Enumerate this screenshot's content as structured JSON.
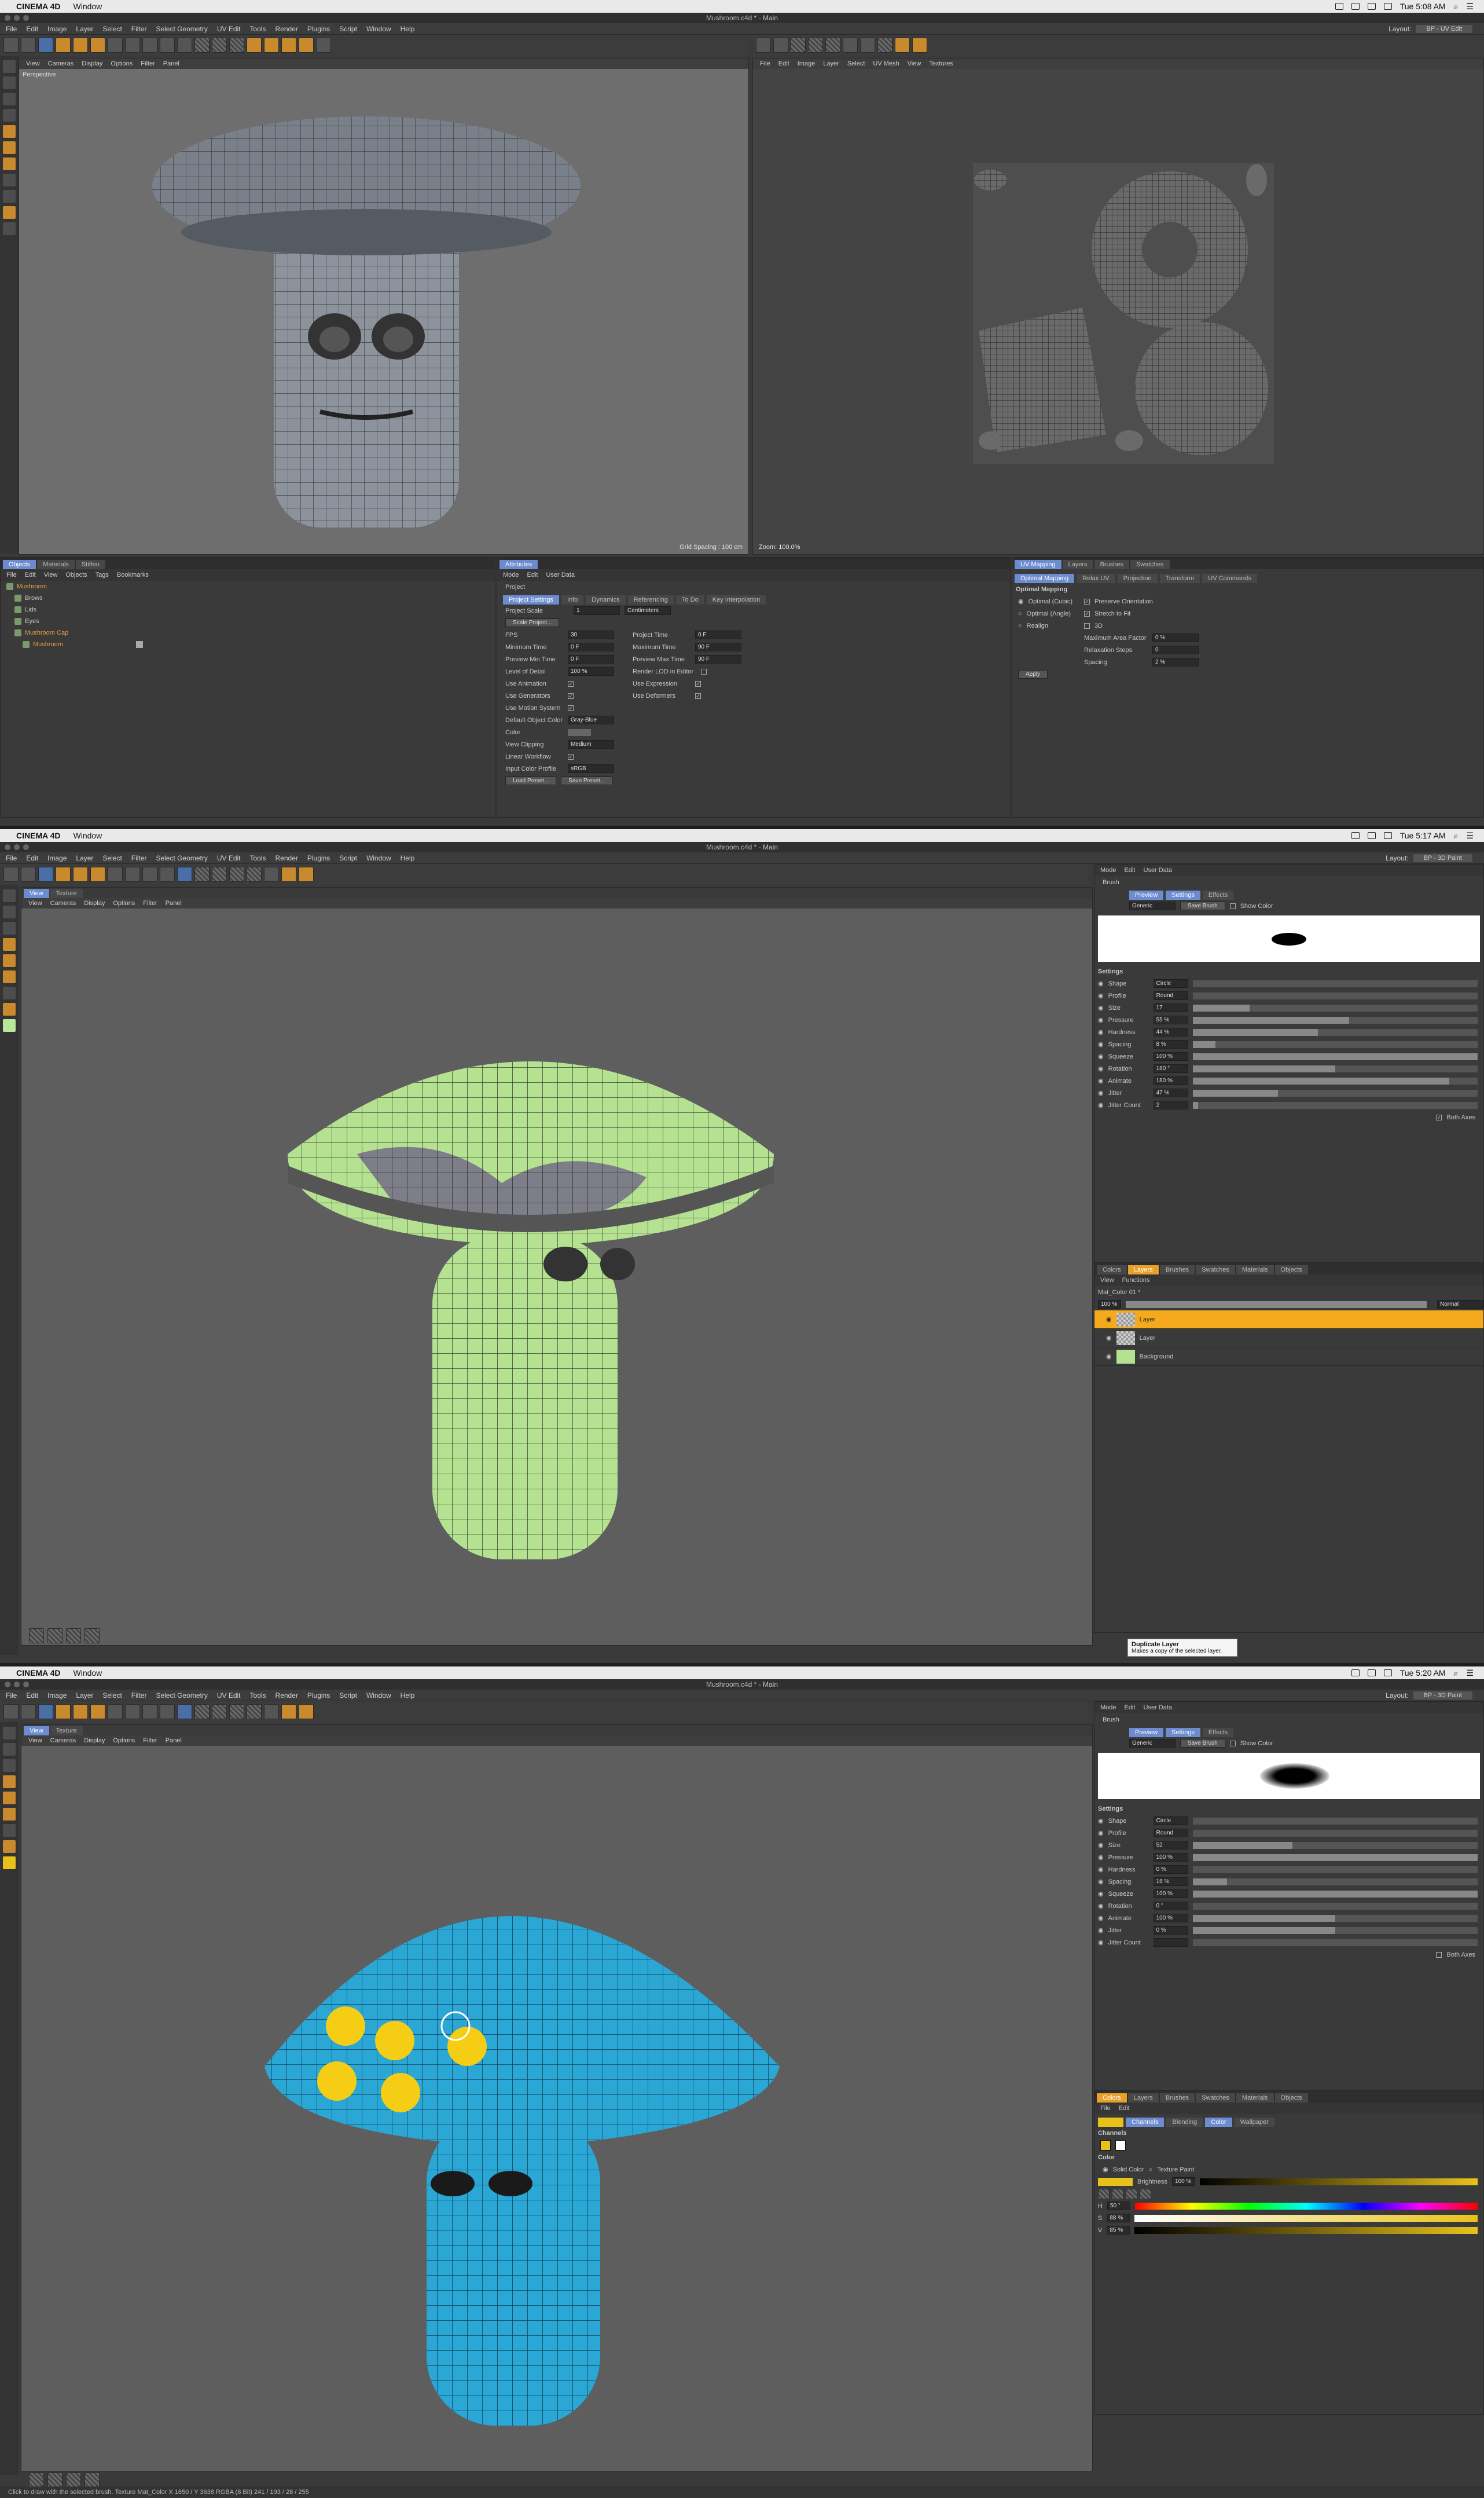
{
  "screens": [
    {
      "mac": {
        "app": "CINEMA 4D",
        "menu": [
          "Window"
        ],
        "time": "Tue 5:08 AM"
      },
      "title": "Mushroom.c4d * - Main",
      "menus": [
        "File",
        "Edit",
        "Image",
        "Layer",
        "Select",
        "Filter",
        "Select Geometry",
        "UV Edit",
        "Tools",
        "Render",
        "Plugins",
        "Script",
        "Window",
        "Help"
      ],
      "layout": {
        "label": "Layout:",
        "value": "BP - UV Edit"
      },
      "viewport": {
        "menu": [
          "View",
          "Cameras",
          "Display",
          "Options",
          "Filter",
          "Panel"
        ],
        "label": "Perspective",
        "footer": "Grid Spacing : 100 cm"
      },
      "uv_view": {
        "menu": [
          "File",
          "Edit",
          "Image",
          "Layer",
          "Select",
          "UV Mesh",
          "View",
          "Textures"
        ],
        "footer": "Zoom: 100.0%"
      },
      "objects": {
        "tabs": [
          "Objects",
          "Materials",
          "Stiffen"
        ],
        "menu": [
          "File",
          "Edit",
          "View",
          "Objects",
          "Tags",
          "Bookmarks"
        ],
        "items": [
          "Mushroom",
          "Brows",
          "Lids",
          "Eyes",
          "Mushroom Cap",
          "Mushroom"
        ]
      },
      "attributes": {
        "tabs": [
          "Attributes"
        ],
        "menu": [
          "Mode",
          "Edit",
          "User Data"
        ],
        "header": "Project",
        "subtabs": [
          "Project Settings",
          "Info",
          "Dynamics",
          "Referencing",
          "To Do",
          "Key Interpolation"
        ],
        "project_scale_label": "Project Scale",
        "project_scale_value": "1",
        "project_scale_unit": "Centimeters",
        "scale_button": "Scale Project...",
        "fields_left": [
          {
            "label": "FPS",
            "value": "30"
          },
          {
            "label": "Minimum Time",
            "value": "0 F"
          },
          {
            "label": "Preview Min Time",
            "value": "0 F"
          },
          {
            "label": "Level of Detail",
            "value": "100 %"
          }
        ],
        "fields_right": [
          {
            "label": "Project Time",
            "value": "0 F"
          },
          {
            "label": "Maximum Time",
            "value": "90 F"
          },
          {
            "label": "Preview Max Time",
            "value": "90 F"
          },
          {
            "label": "Render LOD in Editor",
            "value": ""
          }
        ],
        "checks_left": [
          "Use Animation",
          "Use Generators",
          "Use Motion System"
        ],
        "checks_right": [
          "Use Expression",
          "Use Deformers"
        ],
        "default_color_label": "Default Object Color",
        "default_color_value": "Gray-Blue",
        "color_label": "Color",
        "view_clipping_label": "View Clipping",
        "view_clipping_value": "Medium",
        "linear_label": "Linear Workflow",
        "input_profile_label": "Input Color Profile",
        "input_profile_value": "sRGB",
        "load_btn": "Load Preset...",
        "save_btn": "Save Preset..."
      },
      "uvpanel": {
        "tabs": [
          "UV Mapping",
          "Layers",
          "Brushes",
          "Swatches"
        ],
        "subtabs": [
          "Optimal Mapping",
          "Relax UV",
          "Projection",
          "Transform",
          "UV Commands"
        ],
        "title": "Optimal Mapping",
        "options": [
          "Optimal (Cubic)",
          "Optimal (Angle)",
          "Realign"
        ],
        "opts_right": [
          "Preserve Orientation",
          "Stretch to Fit",
          "3D"
        ],
        "fields": [
          {
            "label": "Maximum Area Factor",
            "value": "0 %"
          },
          {
            "label": "Relaxation Steps",
            "value": "0"
          },
          {
            "label": "Spacing",
            "value": "2 %"
          }
        ],
        "apply": "Apply"
      }
    },
    {
      "mac": {
        "app": "CINEMA 4D",
        "menu": [
          "Window"
        ],
        "time": "Tue 5:17 AM"
      },
      "title": "Mushroom.c4d * - Main",
      "menus": [
        "File",
        "Edit",
        "Image",
        "Layer",
        "Select",
        "Filter",
        "Select Geometry",
        "UV Edit",
        "Tools",
        "Render",
        "Plugins",
        "Script",
        "Window",
        "Help"
      ],
      "layout": {
        "label": "Layout:",
        "value": "BP - 3D Paint"
      },
      "viewtabs": [
        "View",
        "Texture"
      ],
      "viewport": {
        "menu": [
          "View",
          "Cameras",
          "Display",
          "Options",
          "Filter",
          "Panel"
        ]
      },
      "brush": {
        "menu": [
          "Mode",
          "Edit",
          "User Data"
        ],
        "header": "Brush",
        "subtabs": [
          "Preview",
          "Settings",
          "Effects"
        ],
        "preset": "Generic",
        "save_brush": "Save Brush",
        "show_color": "Show Color",
        "settings_title": "Settings",
        "rows": [
          {
            "label": "Shape",
            "value": "Circle",
            "fill": 0
          },
          {
            "label": "Profile",
            "value": "Round",
            "fill": 0
          },
          {
            "label": "Size",
            "value": "17",
            "fill": 0.2
          },
          {
            "label": "Pressure",
            "value": "55 %",
            "fill": 0.55
          },
          {
            "label": "Hardness",
            "value": "44 %",
            "fill": 0.44
          },
          {
            "label": "Spacing",
            "value": "8 %",
            "fill": 0.08
          },
          {
            "label": "Squeeze",
            "value": "100 %",
            "fill": 1.0
          },
          {
            "label": "Rotation",
            "value": "180 °",
            "fill": 0.5
          },
          {
            "label": "Animate",
            "value": "180 %",
            "fill": 0.9
          },
          {
            "label": "Jitter",
            "value": "47 %",
            "fill": 0.3
          },
          {
            "label": "Jitter Count",
            "value": "2",
            "fill": 0.02
          }
        ],
        "both_axes": "Both Axes"
      },
      "layers": {
        "tabs": [
          "Colors",
          "Layers",
          "Brushes",
          "Swatches",
          "Materials",
          "Objects"
        ],
        "menu": [
          "View",
          "Functions"
        ],
        "material": "Mat_Color 01 *",
        "opacity": "100 %",
        "mode": "Normal",
        "items": [
          "Layer",
          "Layer",
          "Background"
        ]
      },
      "tooltip": {
        "title": "Duplicate Layer",
        "desc": "Makes a copy of the selected layer."
      }
    },
    {
      "mac": {
        "app": "CINEMA 4D",
        "menu": [
          "Window"
        ],
        "time": "Tue 5:20 AM"
      },
      "title": "Mushroom.c4d * - Main",
      "menus": [
        "File",
        "Edit",
        "Image",
        "Layer",
        "Select",
        "Filter",
        "Select Geometry",
        "UV Edit",
        "Tools",
        "Render",
        "Plugins",
        "Script",
        "Window",
        "Help"
      ],
      "layout": {
        "label": "Layout:",
        "value": "BP - 3D Paint"
      },
      "viewtabs": [
        "View",
        "Texture"
      ],
      "viewport": {
        "menu": [
          "View",
          "Cameras",
          "Display",
          "Options",
          "Filter",
          "Panel"
        ]
      },
      "brush": {
        "menu": [
          "Mode",
          "Edit",
          "User Data"
        ],
        "header": "Brush",
        "subtabs": [
          "Preview",
          "Settings",
          "Effects"
        ],
        "preset": "Generic",
        "save_brush": "Save Brush",
        "show_color": "Show Color",
        "settings_title": "Settings",
        "rows": [
          {
            "label": "Shape",
            "value": "Circle",
            "fill": 0
          },
          {
            "label": "Profile",
            "value": "Round",
            "fill": 0
          },
          {
            "label": "Size",
            "value": "52",
            "fill": 0.35
          },
          {
            "label": "Pressure",
            "value": "100 %",
            "fill": 1.0
          },
          {
            "label": "Hardness",
            "value": "0 %",
            "fill": 0
          },
          {
            "label": "Spacing",
            "value": "16 %",
            "fill": 0.12
          },
          {
            "label": "Squeeze",
            "value": "100 %",
            "fill": 1.0
          },
          {
            "label": "Rotation",
            "value": "0 °",
            "fill": 0
          },
          {
            "label": "Animate",
            "value": "100 %",
            "fill": 0.5
          },
          {
            "label": "Jitter",
            "value": "0 %",
            "fill": 0.5
          },
          {
            "label": "Jitter Count",
            "value": "",
            "fill": 0
          }
        ],
        "both_axes": "Both Axes"
      },
      "colors": {
        "tabs": [
          "Colors",
          "Layers",
          "Brushes",
          "Swatches",
          "Materials",
          "Objects"
        ],
        "menu": [
          "File",
          "Edit"
        ],
        "subtabs": [
          "Channels",
          "Blending",
          "Color",
          "Wallpaper"
        ],
        "channels_title": "Channels",
        "color_title": "Color",
        "solid": "Solid Color",
        "texture": "Texture Paint",
        "brightness_label": "Brightness",
        "brightness_value": "100 %",
        "hsv": [
          {
            "label": "H",
            "value": "50 °"
          },
          {
            "label": "S",
            "value": "88 %"
          },
          {
            "label": "V",
            "value": "85 %"
          }
        ],
        "fg_color": "#e8c21a"
      },
      "status": "Click to draw with the selected brush. Texture Mat_Color  X 1650 / Y 3638 RGBA (8 Bit) 241 / 193 / 28 / 255"
    }
  ]
}
